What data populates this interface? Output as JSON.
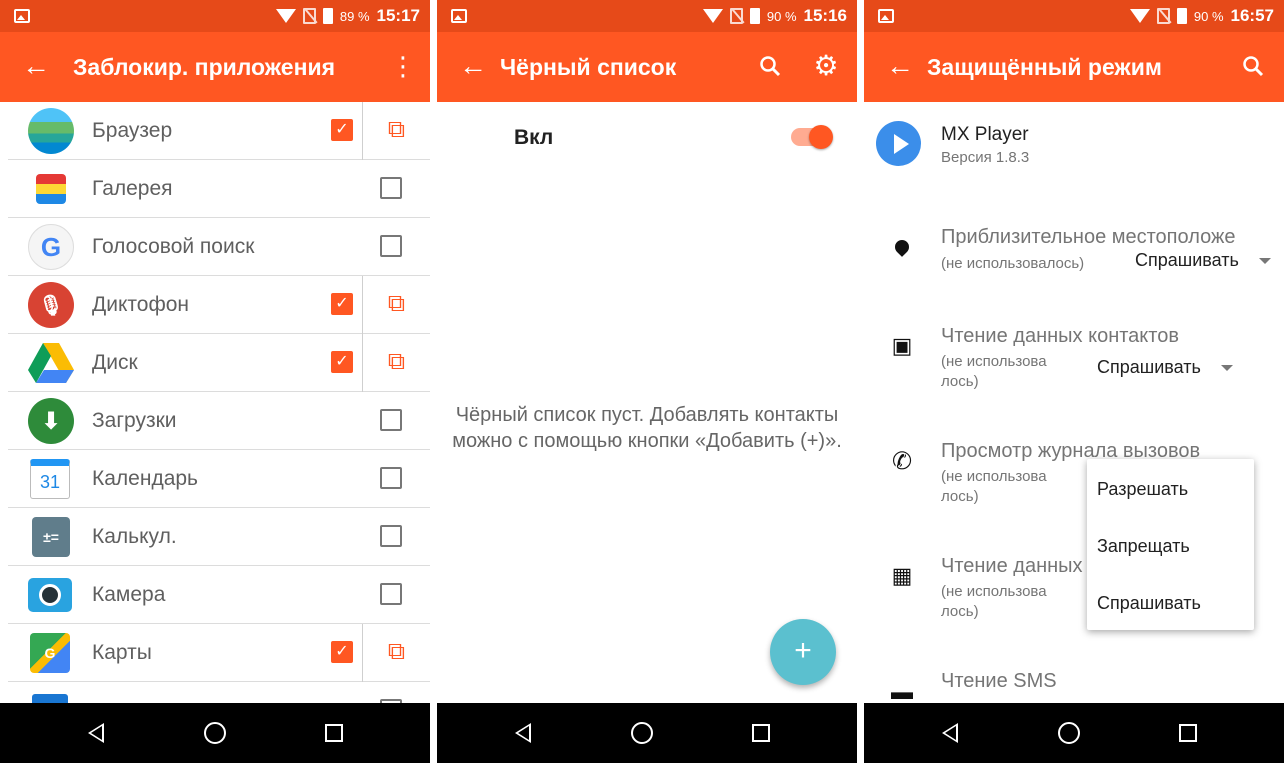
{
  "screens": [
    {
      "status": {
        "battery": "89 %",
        "time": "15:17"
      },
      "title": "Заблокир. приложения",
      "apps": [
        {
          "label": "Браузер",
          "icon": "browser-icon",
          "checked": true
        },
        {
          "label": "Галерея",
          "icon": "gallery-icon",
          "checked": false
        },
        {
          "label": "Голосовой поиск",
          "icon": "google-voice-search-icon",
          "checked": false
        },
        {
          "label": "Диктофон",
          "icon": "microphone-icon",
          "checked": true
        },
        {
          "label": "Диск",
          "icon": "google-drive-icon",
          "checked": true
        },
        {
          "label": "Загрузки",
          "icon": "download-icon",
          "checked": false
        },
        {
          "label": "Календарь",
          "icon": "calendar-icon",
          "icon_text": "31",
          "checked": false
        },
        {
          "label": "Калькул.",
          "icon": "calculator-icon",
          "checked": false
        },
        {
          "label": "Камера",
          "icon": "camera-icon",
          "checked": false
        },
        {
          "label": "Карты",
          "icon": "maps-icon",
          "checked": true
        }
      ]
    },
    {
      "status": {
        "battery": "90 %",
        "time": "15:16"
      },
      "title": "Чёрный список",
      "toggle_label": "Вкл",
      "toggle_on": true,
      "empty_message": "Чёрный список пуст. Добавлять контакты можно с помощью кнопки «Добавить (+)».",
      "fab_label": "+"
    },
    {
      "status": {
        "battery": "90 %",
        "time": "16:57"
      },
      "title": "Защищённый режим",
      "app": {
        "name": "MX Player",
        "version": "Версия 1.8.3"
      },
      "permissions": [
        {
          "title": "Приблизительное местоположе",
          "sub": "(не использовалось)",
          "value": "Спрашивать",
          "icon": "location-pin-icon"
        },
        {
          "title": "Чтение данных контактов",
          "sub": "(не использова лось)",
          "value": "Спрашивать",
          "icon": "contacts-icon"
        },
        {
          "title": "Просмотр журнала вызовов",
          "sub": "(не использова лось)",
          "value": "",
          "icon": "phone-icon"
        },
        {
          "title": "Чтение данных",
          "sub": "(не использова лось)",
          "value": "",
          "icon": "calendar-event-icon"
        },
        {
          "title": "Чтение SMS",
          "sub": "",
          "value": "",
          "icon": "sms-icon"
        }
      ],
      "popup_options": [
        "Разрешать",
        "Запрещать",
        "Спрашивать"
      ]
    }
  ],
  "colors": {
    "status_bar": "#e64a19",
    "app_bar": "#ff5722",
    "accent": "#ff5722",
    "fab": "#5bc0cf"
  }
}
